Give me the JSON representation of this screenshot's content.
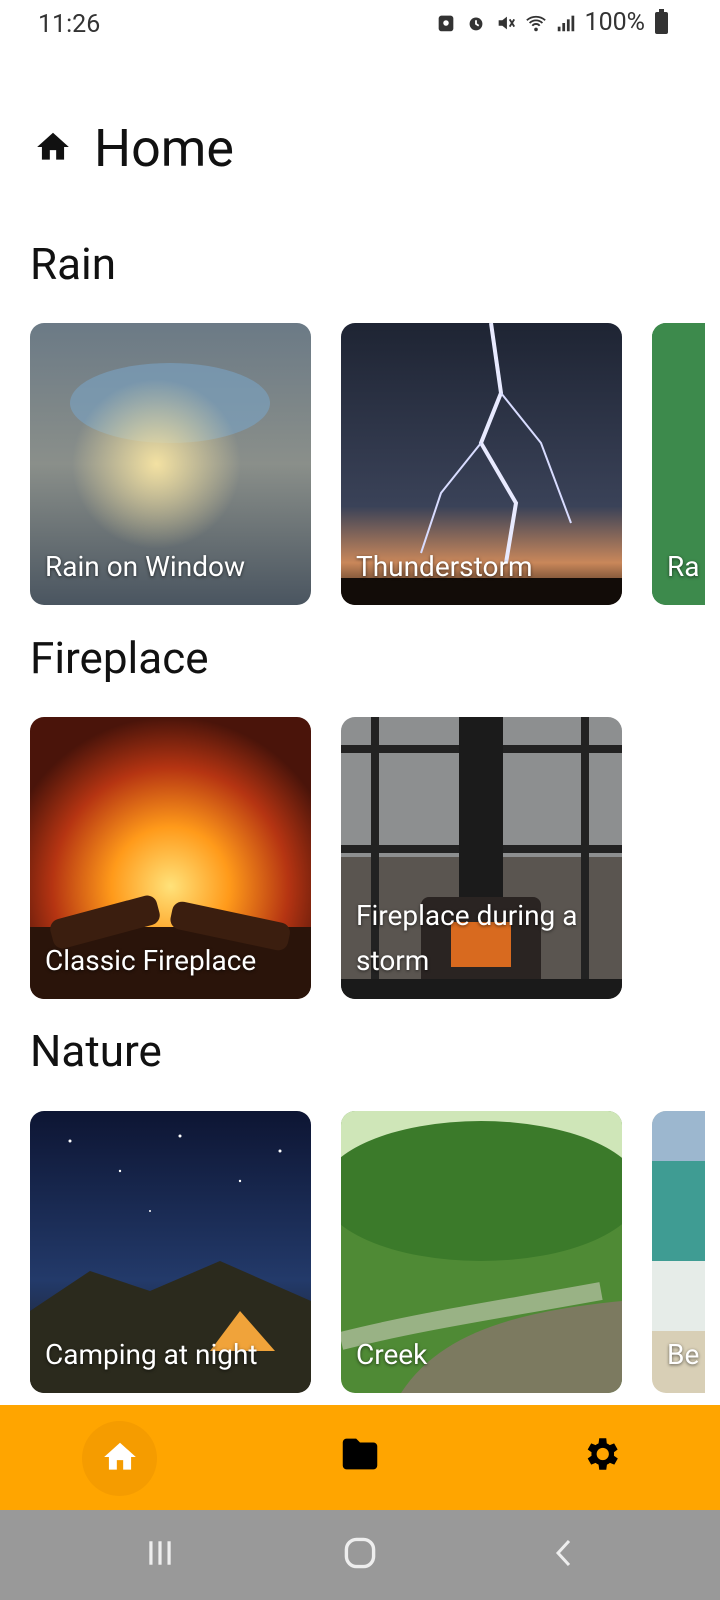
{
  "status_bar": {
    "time": "11:26",
    "battery": "100%"
  },
  "header": {
    "title": "Home"
  },
  "sections": [
    {
      "title": "Rain",
      "cards": [
        {
          "label": "Rain on Window"
        },
        {
          "label": "Thunderstorm"
        },
        {
          "label": "Ra"
        }
      ]
    },
    {
      "title": "Fireplace",
      "cards": [
        {
          "label": "Classic Fireplace"
        },
        {
          "label": "Fireplace during a storm"
        }
      ]
    },
    {
      "title": "Nature",
      "cards": [
        {
          "label": "Camping at night"
        },
        {
          "label": "Creek"
        },
        {
          "label": "Be"
        }
      ]
    }
  ],
  "bottom_nav": {
    "items": [
      {
        "icon": "home-icon",
        "selected": true
      },
      {
        "icon": "folder-icon",
        "selected": false
      },
      {
        "icon": "gear-icon",
        "selected": false
      }
    ],
    "background": "#FFA500"
  },
  "system_nav": {
    "buttons": [
      "recent-apps",
      "home",
      "back"
    ]
  }
}
